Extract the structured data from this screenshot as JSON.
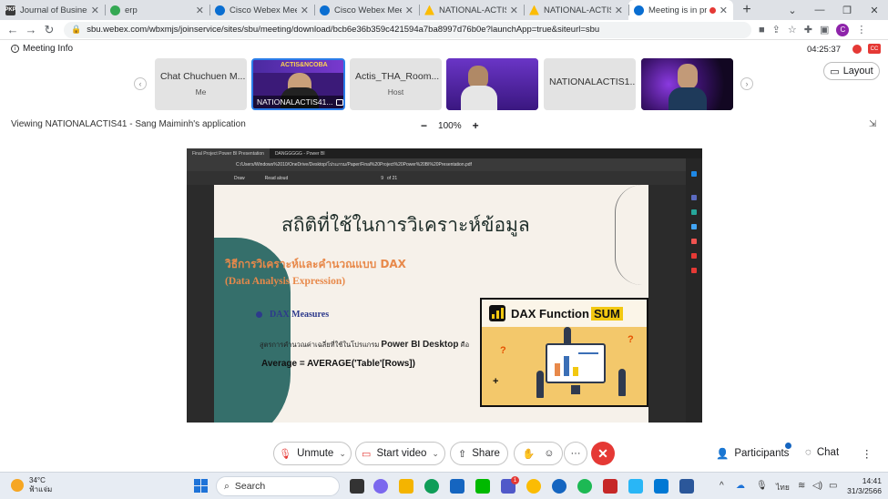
{
  "browser": {
    "tabs": [
      {
        "title": "Journal of Business Ad",
        "favicon": "PKP",
        "color": "#3b3b3b"
      },
      {
        "title": "erp",
        "favicon": "",
        "color": "#34a853"
      },
      {
        "title": "Cisco Webex Meeting",
        "favicon": "",
        "color": "#0a6ed1"
      },
      {
        "title": "Cisco Webex Meeting",
        "favicon": "",
        "color": "#0a6ed1"
      },
      {
        "title": "NATIONAL-ACTIS - G",
        "favicon": "",
        "color": "#fbbc04"
      },
      {
        "title": "NATIONAL-ACTIS - G",
        "favicon": "",
        "color": "#fbbc04"
      },
      {
        "title": "Meeting is in pro",
        "favicon": "",
        "color": "#0a6ed1"
      }
    ],
    "url": "sbu.webex.com/wbxmjs/joinservice/sites/sbu/meeting/download/bcb6e36b359c421594a7ba8997d76b0e?launchApp=true&siteurl=sbu",
    "profile_initial": "C"
  },
  "meeting": {
    "info_label": "Meeting Info",
    "timer": "04:25:37",
    "layout_label": "Layout",
    "viewing_text": "Viewing NATIONALACTIS41 - Sang Maiminh's application",
    "zoom_level": "100%",
    "participants": [
      {
        "name": "Chat Chuchuen M...",
        "sub": "Me"
      },
      {
        "name": "NATIONALACTIS41...",
        "sub": ""
      },
      {
        "name": "Actis_THA_Room...",
        "sub": "Host"
      },
      {
        "name": "",
        "sub": ""
      },
      {
        "name": "NATIONALACTIS1...",
        "sub": ""
      },
      {
        "name": "",
        "sub": ""
      }
    ],
    "thumb_overlay_text": "ACTIS&NCOBA"
  },
  "shared_screen": {
    "edge_tabs": [
      "Final Project Power BI Presentation",
      "DANGGGGG - Power BI"
    ],
    "edge_path": "C:/Users/Windows%2010/OneDrive/Desktop/โปรแกรม/Paper/Final%20Project%20Power%20BI%20Presentation.pdf",
    "pdf_toolbar": [
      "Draw",
      "Read aloud",
      "of 21"
    ],
    "page_number": "9",
    "slide": {
      "title": "สถิติที่ใช้ในการวิเคราะห์ข้อมูล",
      "subtitle_th": "วิธีการวิเคราะห์และคำนวณแบบ DAX",
      "subtitle_en": "(Data Analysis Expression)",
      "bullet": "DAX Measures",
      "body_prefix": "สูตรการคำนวณค่าเฉลี่ยที่ใช้ในโปรแกรม",
      "body_app": "Power BI Desktop",
      "body_suffix": "คือ",
      "formula": "Average = AVERAGE('Table'[Rows])",
      "card_title": "DAX Function",
      "card_highlight": "SUM"
    }
  },
  "controls": {
    "unmute": "Unmute",
    "start_video": "Start video",
    "share": "Share",
    "participants": "Participants",
    "chat": "Chat"
  },
  "taskbar": {
    "temperature": "34°C",
    "weather_text": "ฟ้าแจ่ม",
    "search": "Search",
    "language": "ไทย",
    "time": "14:41",
    "date": "31/3/2566",
    "teams_badge": "1"
  },
  "colors": {
    "accent": "#2b7de9",
    "end_call": "#e53935",
    "slide_teal": "#356f6b",
    "slide_orange": "#e8894a",
    "power_bi_yellow": "#f2c811"
  }
}
